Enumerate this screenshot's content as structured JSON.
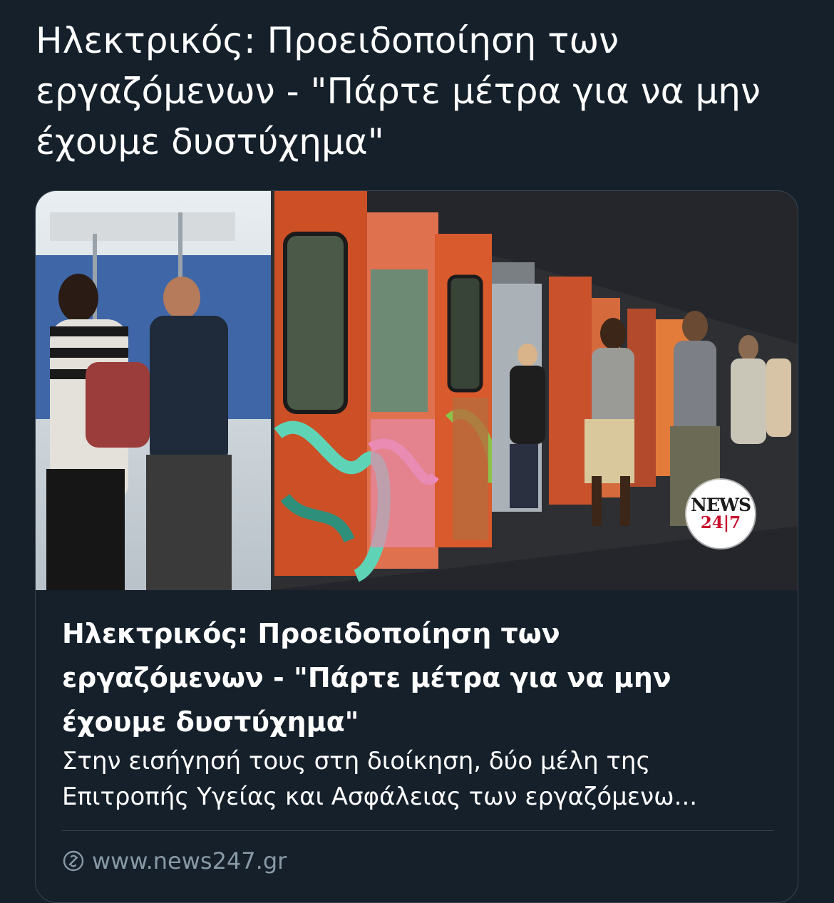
{
  "tweet": {
    "text": "Ηλεκτρικός: Προειδοποίηση των εργαζόμενων - \"Πάρτε μέτρα για να μην έχουμε δυστύχημα\""
  },
  "card": {
    "title": "Ηλεκτρικός: Προειδοποίηση των εργαζόμενων - \"Πάρτε μέτρα για να μην έχουμε δυστύχημα\"",
    "description": "Στην εισήγησή τους στη διοίκηση, δύο μέλη της Επιτροπής Υγείας και Ασφάλειας των εργαζόμενω...",
    "domain": "www.news247.gr",
    "domain_icon": "link-globe-icon",
    "logo": {
      "line1": "NEWS",
      "line2": "24|7"
    }
  },
  "colors": {
    "background": "#15202b",
    "border": "#38444d",
    "secondary_text": "#8899a6",
    "text": "#ffffff",
    "logo_red": "#c8102e"
  }
}
